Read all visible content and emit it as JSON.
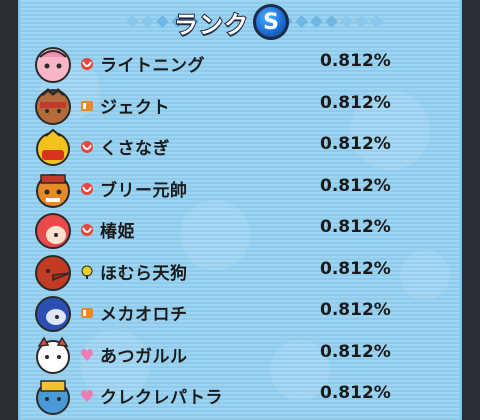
{
  "header": {
    "title": "ランク",
    "rank": "S"
  },
  "colors": {
    "background": "#9fd4f1",
    "badge": "#1b6fd6",
    "text": "#1b1b1b"
  },
  "rows": [
    {
      "name": "ライトニング",
      "pct": "0.812%",
      "avatar": "lightning-avatar-icon",
      "tribe": "eerie-tribe-icon"
    },
    {
      "name": "ジェクト",
      "pct": "0.812%",
      "avatar": "ject-avatar-icon",
      "tribe": "brave-tribe-icon"
    },
    {
      "name": "くさなぎ",
      "pct": "0.812%",
      "avatar": "kusanagi-avatar-icon",
      "tribe": "eerie-tribe-icon"
    },
    {
      "name": "ブリー元帥",
      "pct": "0.812%",
      "avatar": "bully-marshal-avatar-icon",
      "tribe": "eerie-tribe-icon"
    },
    {
      "name": "椿姫",
      "pct": "0.812%",
      "avatar": "tsubakihime-avatar-icon",
      "tribe": "eerie-tribe-icon"
    },
    {
      "name": "ほむら天狗",
      "pct": "0.812%",
      "avatar": "homura-tengu-avatar-icon",
      "tribe": "mysterious-tribe-icon"
    },
    {
      "name": "メカオロチ",
      "pct": "0.812%",
      "avatar": "meka-orochi-avatar-icon",
      "tribe": "brave-tribe-icon"
    },
    {
      "name": "あつガルル",
      "pct": "0.812%",
      "avatar": "atsu-garuru-avatar-icon",
      "tribe": "charming-tribe-icon"
    },
    {
      "name": "クレクレパトラ",
      "pct": "0.812%",
      "avatar": "kurekure-patra-avatar-icon",
      "tribe": "charming-tribe-icon"
    }
  ]
}
